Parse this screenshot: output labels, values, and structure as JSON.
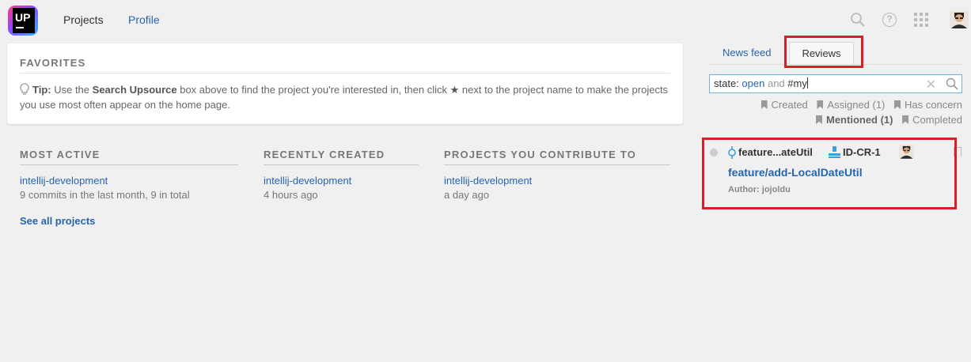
{
  "header": {
    "logo_text": "UP",
    "nav": {
      "projects": "Projects",
      "profile": "Profile"
    },
    "icons": [
      "search-icon",
      "help-icon",
      "apps-grid-icon",
      "user-avatar"
    ],
    "help_glyph": "?"
  },
  "favorites": {
    "heading": "FAVORITES",
    "tip_label": "Tip:",
    "tip_part1": "Use the",
    "tip_bold": "Search Upsource",
    "tip_part2": "box above to find the project you're interested in, then click",
    "tip_star": "★",
    "tip_part3": "next to the project name to make the projects you use most often appear on the home page."
  },
  "columns": [
    {
      "heading": "MOST ACTIVE",
      "project": "intellij-development",
      "meta": "9 commits in the last month, 9 in total"
    },
    {
      "heading": "RECENTLY CREATED",
      "project": "intellij-development",
      "meta": "4 hours ago"
    },
    {
      "heading": "PROJECTS YOU CONTRIBUTE TO",
      "project": "intellij-development",
      "meta": "a day ago"
    }
  ],
  "see_all": "See all projects",
  "right_panel": {
    "tabs": {
      "news_feed": "News feed",
      "reviews": "Reviews"
    },
    "search": {
      "key": "state:",
      "value": "open",
      "op": "and",
      "tag": "#my"
    },
    "filters": {
      "created": "Created",
      "assigned": "Assigned (1)",
      "has_concern": "Has concern",
      "mentioned": "Mentioned (1)",
      "completed": "Completed"
    },
    "review": {
      "branch": "feature...ateUtil",
      "id": "ID-CR-1",
      "title": "feature/add-LocalDateUtil",
      "author": "Author: jojoldu"
    }
  },
  "colors": {
    "link": "#2665ad",
    "highlight": "#d81e2b",
    "background": "#f0f0f0"
  }
}
